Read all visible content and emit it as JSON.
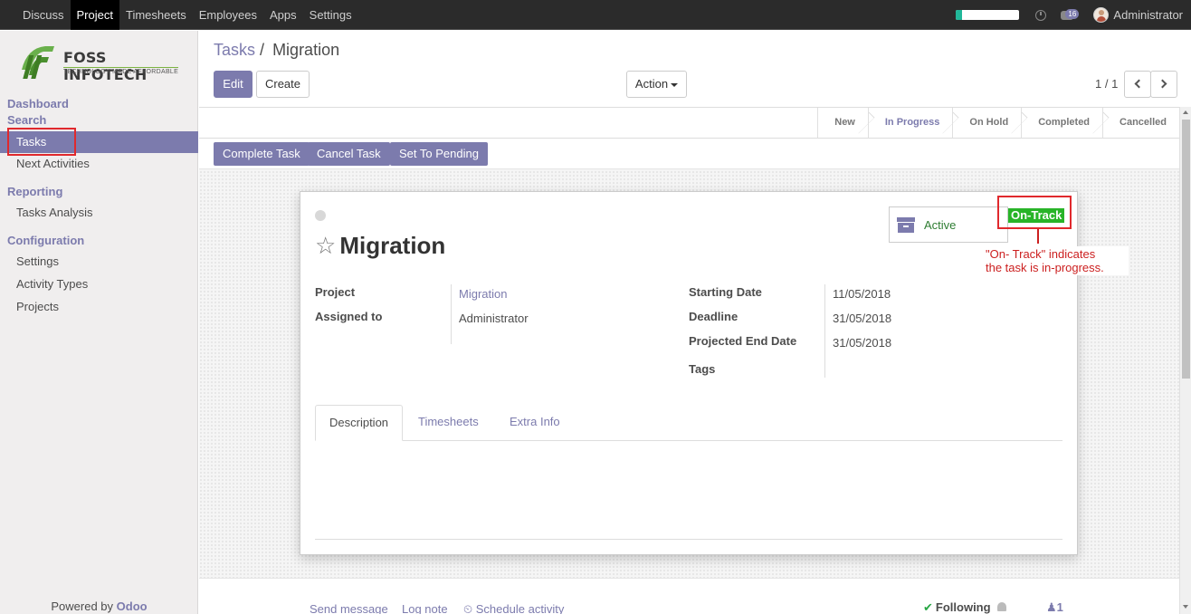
{
  "topnav": {
    "menu": [
      "Discuss",
      "Project",
      "Timesheets",
      "Employees",
      "Apps",
      "Settings"
    ],
    "active": "Project",
    "progress": 0.1,
    "chat_badge": "16",
    "user": "Administrator"
  },
  "sidebar": {
    "logo_name": "FOSS INFOTECH",
    "logo_tagline": "TECHNOLOGY MADE AFFORDABLE",
    "sections": {
      "dashboard": "Dashboard",
      "search": "Search",
      "reporting": "Reporting",
      "configuration": "Configuration"
    },
    "items": {
      "tasks": "Tasks",
      "next_activities": "Next Activities",
      "tasks_analysis": "Tasks Analysis",
      "settings": "Settings",
      "activity_types": "Activity Types",
      "projects": "Projects"
    },
    "powered_prefix": "Powered by ",
    "powered_brand": "Odoo"
  },
  "control": {
    "breadcrumb_parent": "Tasks",
    "breadcrumb_sep": "/",
    "breadcrumb_current": "Migration",
    "edit": "Edit",
    "create": "Create",
    "action": "Action",
    "pager": "1 / 1"
  },
  "stages": [
    "New",
    "In Progress",
    "On Hold",
    "Completed",
    "Cancelled"
  ],
  "current_stage": "In Progress",
  "actions": {
    "complete": "Complete Task",
    "cancel": "Cancel Task",
    "pending": "Set To Pending"
  },
  "form": {
    "title": "Migration",
    "active_label": "Active",
    "status_badge": "On-Track",
    "fields": {
      "project_label": "Project",
      "project_value": "Migration",
      "assigned_label": "Assigned to",
      "assigned_value": "Administrator",
      "start_label": "Starting Date",
      "start_value": "11/05/2018",
      "deadline_label": "Deadline",
      "deadline_value": "31/05/2018",
      "projected_label": "Projected End Date",
      "projected_value": "31/05/2018",
      "tags_label": "Tags"
    },
    "tabs": [
      "Description",
      "Timesheets",
      "Extra Info"
    ]
  },
  "chatter": {
    "send_message": "Send message",
    "log_note": "Log note",
    "schedule": "Schedule activity",
    "following": "Following",
    "followers": "1"
  },
  "annotation": {
    "line1": "\"On- Track\" indicates",
    "line2": "the task is in-progress."
  },
  "colors": {
    "brand": "#7c7bad",
    "on_track": "#28b428",
    "annotation": "#cc2020"
  }
}
